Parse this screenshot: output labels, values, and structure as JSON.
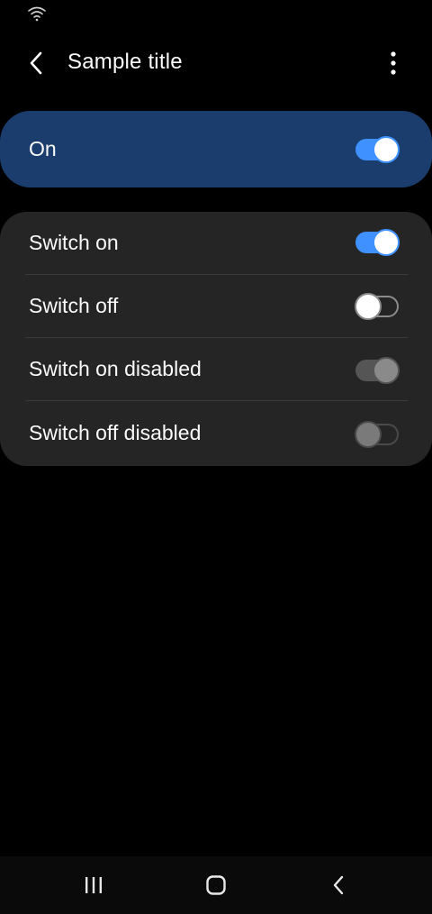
{
  "status_bar": {
    "wifi_icon": "wifi-icon"
  },
  "app_bar": {
    "title": "Sample title",
    "back_icon": "chevron-left-icon",
    "more_icon": "more-vert-icon"
  },
  "master_switch": {
    "label": "On",
    "state": "on",
    "accent": "#3e91ff",
    "background": "#1b3d6e"
  },
  "switches": [
    {
      "label": "Switch on",
      "state": "on",
      "disabled": false
    },
    {
      "label": "Switch off",
      "state": "off",
      "disabled": false
    },
    {
      "label": "Switch on disabled",
      "state": "on",
      "disabled": true
    },
    {
      "label": "Switch off disabled",
      "state": "off",
      "disabled": true
    }
  ],
  "nav_bar": {
    "recents_icon": "recents-icon",
    "home_icon": "home-icon",
    "back_icon": "back-icon"
  }
}
